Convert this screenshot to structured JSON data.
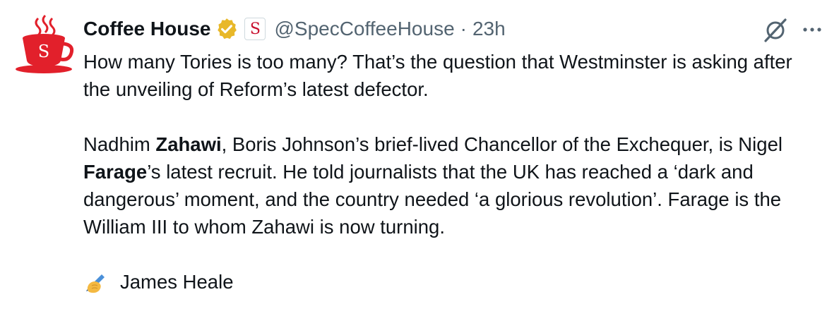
{
  "tweet": {
    "author": {
      "display_name": "Coffee House",
      "handle": "@SpecCoffeeHouse",
      "separator": "·",
      "time": "23h",
      "affiliate_badge_letter": "S",
      "avatar_letter": "S",
      "avatar_icon": "red-coffee-cup-icon",
      "verified_icon": "gold-verified-badge-icon"
    },
    "paragraph1": "How many Tories is too many? That’s the question that Westminster is asking after the unveiling of Reform’s latest defector.",
    "paragraph2": {
      "part1": "Nadhim ",
      "bold1": "Zahawi",
      "part2": ", Boris Johnson’s brief-lived Chancellor of the Exchequer, is Nigel ",
      "bold2": "Farage",
      "part3": "’s latest recruit. He told journalists that the UK has reached a ‘dark and dangerous’ moment, and the country needed ‘a glorious revolution’. Farage is the William III to whom Zahawi is now turning."
    },
    "byline": {
      "icon": "writing-hand-icon",
      "name": "James Heale"
    },
    "actions": {
      "grok_icon": "grok-icon",
      "more_icon": "more-options-icon"
    },
    "colors": {
      "brand_red": "#e2202b",
      "verified_gold": "#e8b829",
      "secondary_text": "#536471",
      "primary_text": "#0f1419"
    }
  }
}
